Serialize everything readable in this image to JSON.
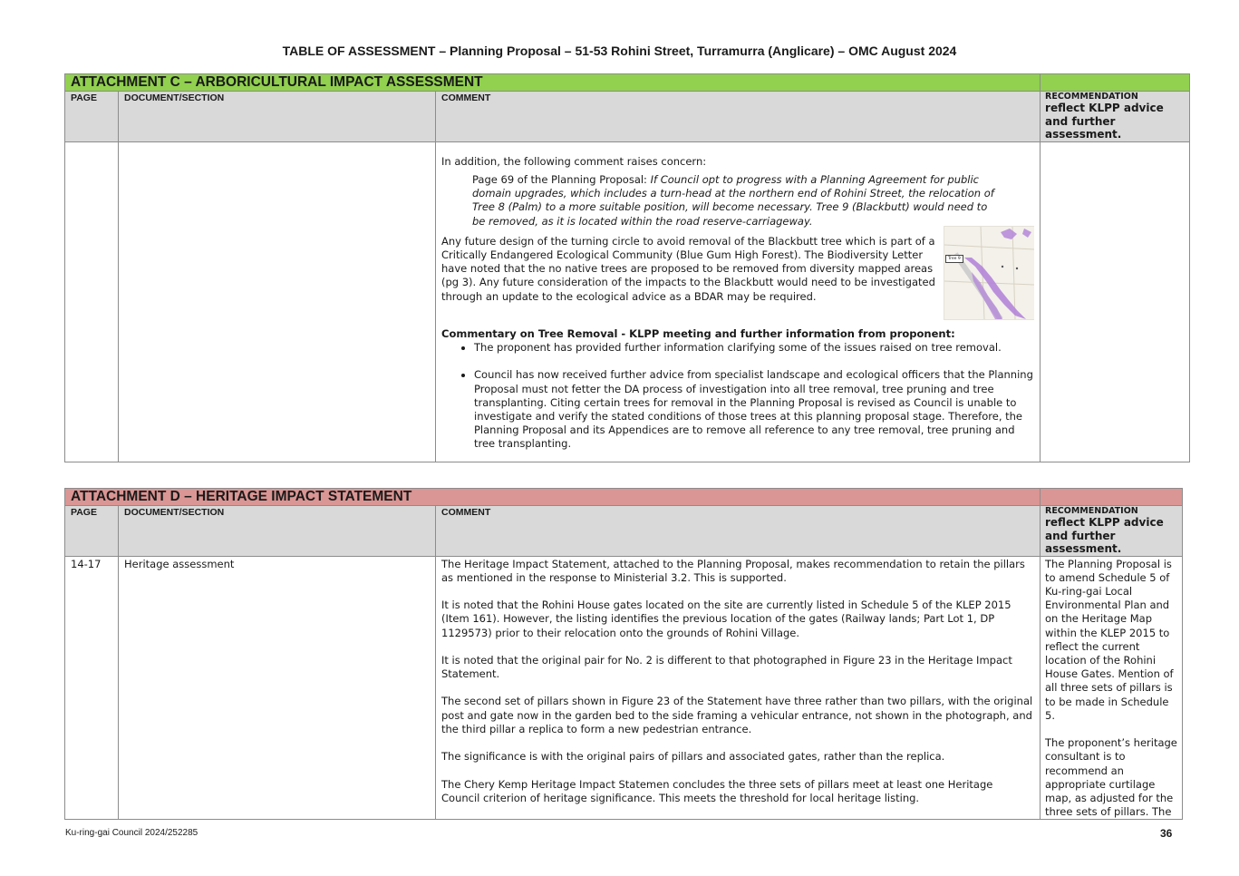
{
  "document": {
    "title": "TABLE OF ASSESSMENT – Planning Proposal – 51-53 Rohini Street, Turramurra (Anglicare) – OMC August 2024"
  },
  "colors": {
    "attachment_c_header": "#92d050",
    "attachment_d_header": "#da9694",
    "column_header_bg": "#d9d9d9"
  },
  "columns": {
    "page": "PAGE",
    "section": "DOCUMENT/SECTION",
    "comment": "COMMENT",
    "recommendation": "RECOMMENDATION",
    "recommendation_sub": "reflect KLPP advice and further assessment."
  },
  "attachment_c": {
    "title": "ATTACHMENT C – ARBORICULTURAL IMPACT ASSESSMENT",
    "intro": "In addition, the following comment raises concern:",
    "quote_lead": "Page 69 of the Planning Proposal: ",
    "quote": "If Council opt to progress with a Planning Agreement for public domain upgrades, which includes a turn-head at the northern end of Rohini Street, the relocation of Tree 8 (Palm) to a more suitable position, will become necessary. Tree 9 (Blackbutt) would need to be removed, as it is located within the road reserve-carriageway.",
    "paragraph": "Any future design of the turning circle to avoid removal of the Blackbutt tree which is part of a Critically Endangered Ecological Community (Blue Gum High Forest). The Biodiversity Letter have noted that the no native trees are proposed to be removed from diversity mapped areas (pg 3). Any future consideration of the impacts to the Blackbutt would need to be investigated through an update to the ecological advice as a BDAR may be required.",
    "map_label": "Tree 9",
    "commentary_heading": "Commentary on Tree Removal - KLPP meeting and further information from proponent:",
    "bullets": [
      "The proponent has provided further information clarifying some of the issues raised on tree removal.",
      "Council has now received further advice from specialist landscape and ecological officers that the Planning Proposal must not fetter the DA process of investigation into all tree removal, tree pruning and tree transplanting. Citing certain trees for removal in the Planning Proposal is revised as Council is unable to investigate and verify the stated conditions of those trees at this planning proposal stage. Therefore, the Planning Proposal and its Appendices are to remove all reference to any tree removal, tree pruning and tree transplanting."
    ]
  },
  "attachment_d": {
    "title": "ATTACHMENT D – HERITAGE IMPACT STATEMENT",
    "row": {
      "page": "14-17",
      "section": "Heritage assessment",
      "comments": [
        "The Heritage Impact Statement, attached to the Planning Proposal, makes recommendation to retain the pillars as mentioned in the response to Ministerial 3.2. This is supported.",
        "It is noted that the Rohini House gates located on the site are currently listed in Schedule 5 of the KLEP 2015  (Item 161). However, the listing identifies the previous location of the gates (Railway lands; Part Lot 1, DP 1129573) prior to their relocation onto the grounds of Rohini Village.",
        "It is noted that the original pair for No. 2 is different to that photographed in Figure 23 in the Heritage Impact Statement.",
        "The second set of pillars shown in Figure 23 of the Statement have three rather than two pillars, with the original post and gate now in the garden bed to the side framing a vehicular entrance, not shown in the photograph, and the third pillar a replica to form a new pedestrian entrance.",
        "The significance is with the original pairs of pillars and associated gates, rather than the replica.",
        "The Chery Kemp Heritage Impact Statemen concludes the three sets of pillars meet at least one Heritage Council criterion of heritage significance. This meets the threshold for local heritage listing."
      ],
      "recommendations": [
        "The Planning Proposal is to amend Schedule 5 of Ku-ring-gai Local Environmental Plan and on the Heritage Map within the KLEP 2015 to reflect the current location of the Rohini House Gates. Mention of all three sets of pillars is to be made in Schedule 5.",
        "The proponent’s heritage consultant is to recommend an appropriate curtilage map, as adjusted for the three sets of pillars. The"
      ]
    }
  },
  "footer": {
    "reference": "Ku-ring-gai Council 2024/252285",
    "page_number": "36"
  }
}
